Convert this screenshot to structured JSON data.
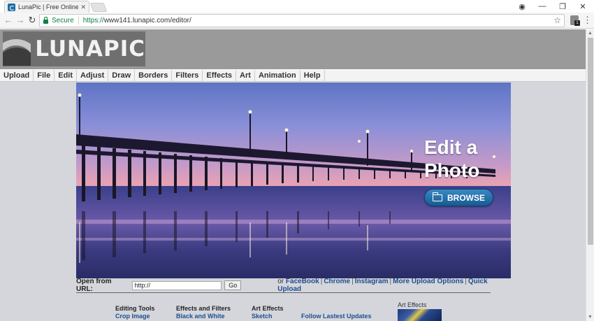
{
  "browser": {
    "tab_title": "LunaPic | Free Online Ph",
    "tab_close": "✕",
    "secure_label": "Secure",
    "url_scheme": "https://",
    "url_rest": "www141.lunapic.com/editor/",
    "ext_badge": "1",
    "window_controls": {
      "profile": "◉",
      "minimize": "—",
      "restore": "❐",
      "close": "✕"
    }
  },
  "site": {
    "logo_text": "LUNAPIC",
    "menu": [
      "Upload",
      "File",
      "Edit",
      "Adjust",
      "Draw",
      "Borders",
      "Filters",
      "Effects",
      "Art",
      "Animation",
      "Help"
    ]
  },
  "hero": {
    "title_line1": "Edit a",
    "title_line2": "Photo",
    "browse_label": "BROWSE"
  },
  "url_row": {
    "label": "Open from URL:",
    "input_value": "http://",
    "go_label": "Go",
    "or_text": "or",
    "links": [
      "FaceBook",
      "Chrome",
      "Instagram",
      "More Upload Options",
      "Quick Upload"
    ]
  },
  "footer": {
    "columns": [
      {
        "head": "Editing Tools",
        "link": "Crop Image"
      },
      {
        "head": "Effects and Filters",
        "link": "Black and White"
      },
      {
        "head": "Art Effects",
        "link": "Sketch"
      }
    ],
    "follow_link": "Follow Lastest Updates",
    "art_label": "Art Effects"
  }
}
